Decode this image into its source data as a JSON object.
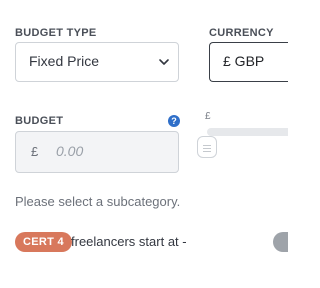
{
  "budget_type": {
    "label": "BUDGET TYPE",
    "selected": "Fixed Price"
  },
  "currency": {
    "label": "CURRENCY",
    "selected": "£ GBP"
  },
  "budget": {
    "label": "BUDGET",
    "symbol": "£",
    "placeholder": "0.00"
  },
  "slider": {
    "symbol": "£"
  },
  "subcategory_message": "Please select a subcategory.",
  "cert_badge": "CERT 4",
  "freelancers_text": "freelancers start at -",
  "icons": {
    "select_chevron": "chevron-down-icon",
    "help": "question-circle-icon",
    "slider_grip": "grip-lines-icon"
  },
  "colors": {
    "badge_orange": "#d8785c",
    "help_blue": "#2f6fc9",
    "grey_badge": "#9ea3a9"
  }
}
